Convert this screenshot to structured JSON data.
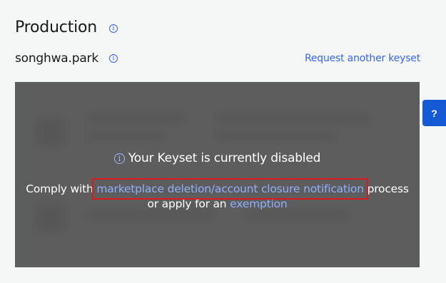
{
  "environment": {
    "title": "Production",
    "title_info_icon": "info-icon"
  },
  "keyset": {
    "username": "songhwa.park",
    "username_info_icon": "info-icon",
    "request_link": "Request another keyset"
  },
  "disabled_overlay": {
    "icon": "info-icon",
    "title": "Your Keyset is currently disabled",
    "message_prefix": "Comply with",
    "notification_link": "marketplace deletion/account closure notification",
    "message_middle": "process",
    "message_apply": "or apply for an",
    "exemption_link": "exemption"
  },
  "help_button": {
    "label": "?"
  },
  "colors": {
    "link": "#3665f3",
    "overlay_link": "#8fb0ff",
    "highlight_box": "#e0191f",
    "help_button": "#1559d5"
  }
}
